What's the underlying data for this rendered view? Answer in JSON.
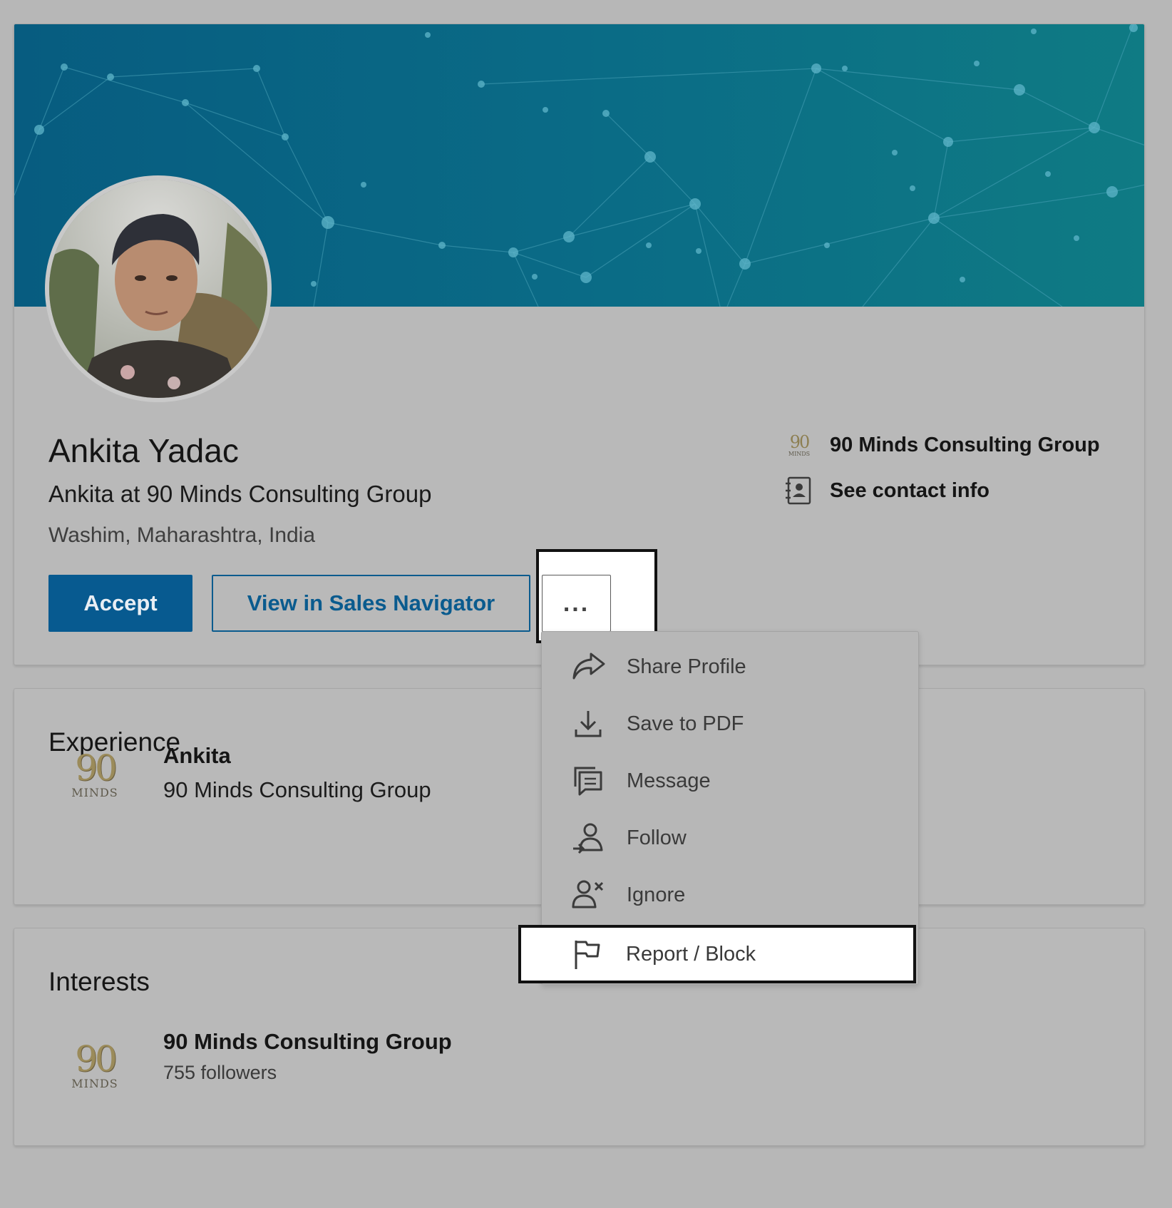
{
  "profile": {
    "name": "Ankita Yadac",
    "headline": "Ankita at 90 Minds Consulting Group",
    "location": "Washim, Maharashtra, India"
  },
  "actions": {
    "accept_label": "Accept",
    "sales_nav_label": "View in Sales Navigator",
    "more_label": "..."
  },
  "side": {
    "company": "90 Minds Consulting Group",
    "contact": "See contact info"
  },
  "menu": {
    "items": [
      {
        "label": "Share Profile",
        "icon": "share-icon"
      },
      {
        "label": "Save to PDF",
        "icon": "download-icon"
      },
      {
        "label": "Message",
        "icon": "message-icon"
      },
      {
        "label": "Follow",
        "icon": "follow-icon"
      },
      {
        "label": "Ignore",
        "icon": "ignore-icon"
      },
      {
        "label": "Report / Block",
        "icon": "flag-icon"
      }
    ]
  },
  "experience": {
    "title": "Experience",
    "role": "Ankita",
    "company": "90 Minds Consulting Group"
  },
  "interests": {
    "title": "Interests",
    "name": "90 Minds Consulting Group",
    "followers": "755 followers"
  },
  "logo": {
    "numerals": "90",
    "word": "MINDS"
  },
  "colors": {
    "primary": "#075a90",
    "banner": "#0a6b86",
    "background": "#b7b7b7"
  }
}
